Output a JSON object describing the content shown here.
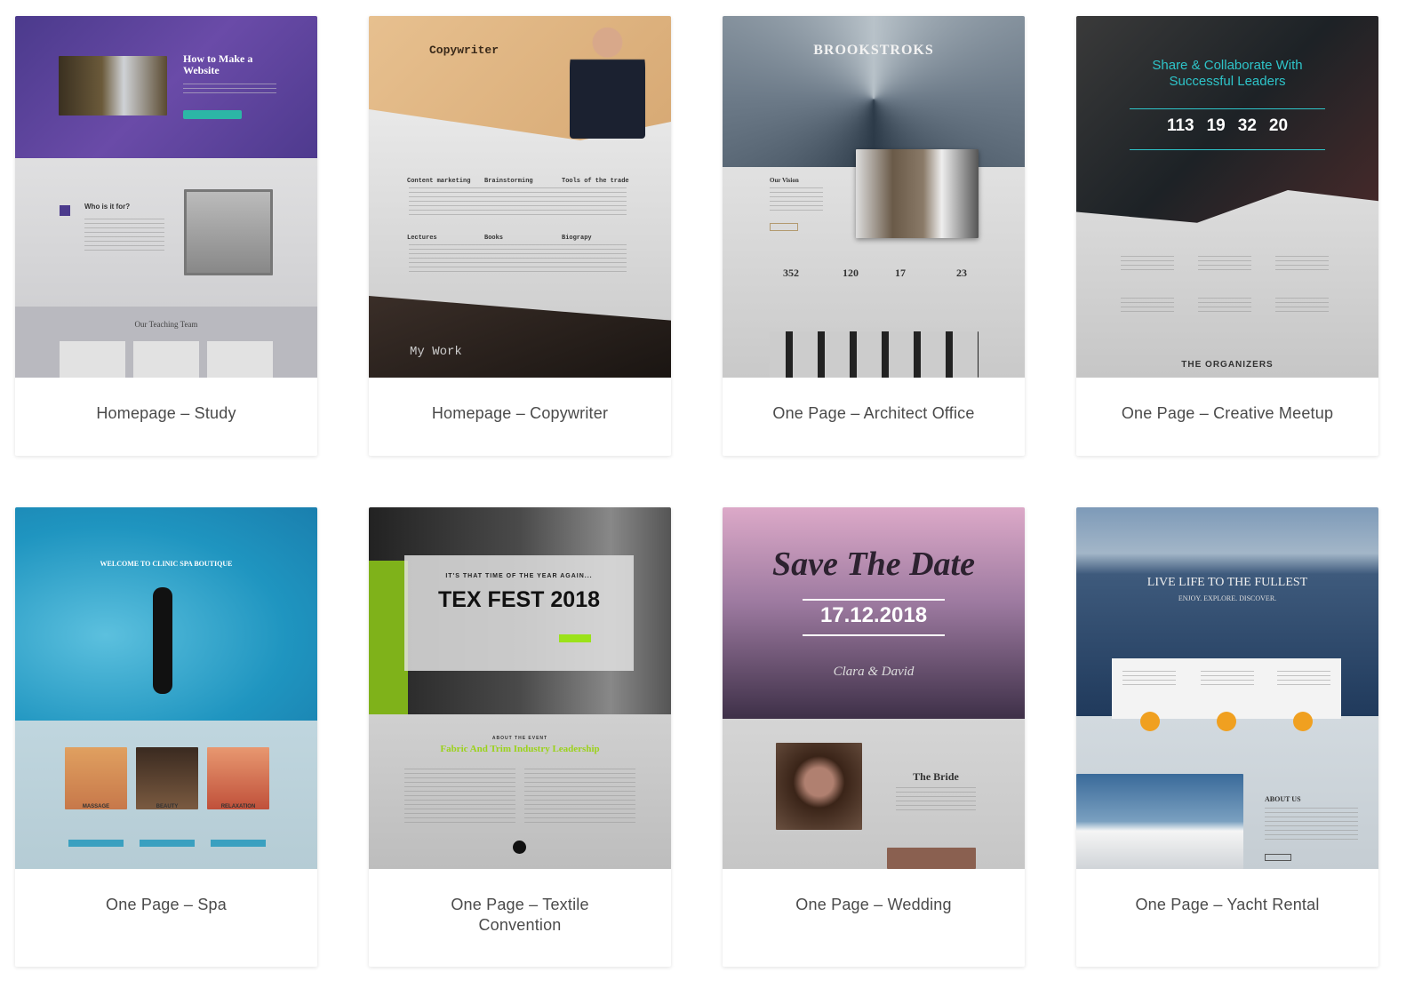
{
  "cards": [
    {
      "title": "Homepage – Study",
      "preview": {
        "heading": "How to Make a Website",
        "section": "Who is it for?",
        "team": "Our Teaching Team"
      }
    },
    {
      "title": "Homepage – Copywriter",
      "preview": {
        "heading": "Copywriter",
        "features": [
          "Content marketing",
          "Brainstorming",
          "Tools of the trade",
          "Lectures",
          "Books",
          "Biograpy"
        ],
        "work": "My Work"
      }
    },
    {
      "title": "One Page – Architect Office",
      "preview": {
        "heading": "BROOKSTROKS",
        "vision": "Our Vision",
        "stats": [
          "352",
          "120",
          "17",
          "23"
        ]
      }
    },
    {
      "title": "One Page – Creative Meetup",
      "preview": {
        "heading": "Share & Collaborate With Successful Leaders",
        "countdown": [
          "113",
          "19",
          "32",
          "20"
        ],
        "organizers": "THE ORGANIZERS"
      }
    },
    {
      "title": "One Page – Spa",
      "preview": {
        "heading": "WELCOME TO CLINIC SPA BOUTIQUE",
        "services": [
          "MASSAGE",
          "BEAUTY",
          "RELAXATION"
        ]
      }
    },
    {
      "title": "One Page – Textile Convention",
      "preview": {
        "kicker": "IT'S THAT TIME OF THE YEAR AGAIN...",
        "heading": "TEX FEST 2018",
        "about": "ABOUT THE EVENT",
        "subheading": "Fabric And Trim Industry Leadership"
      }
    },
    {
      "title": "One Page – Wedding",
      "preview": {
        "heading": "Save The Date",
        "date": "17.12.2018",
        "names": "Clara & David",
        "bride": "The Bride"
      }
    },
    {
      "title": "One Page – Yacht Rental",
      "preview": {
        "heading": "LIVE LIFE TO THE FULLEST",
        "subheading": "ENJOY. EXPLORE. DISCOVER.",
        "about": "ABOUT US"
      }
    }
  ],
  "colors": {
    "title_text": "#4a4a4a",
    "study_purple": "#5a3f93",
    "meetup_teal": "#2ec4c9",
    "textile_green": "#9be21a"
  }
}
